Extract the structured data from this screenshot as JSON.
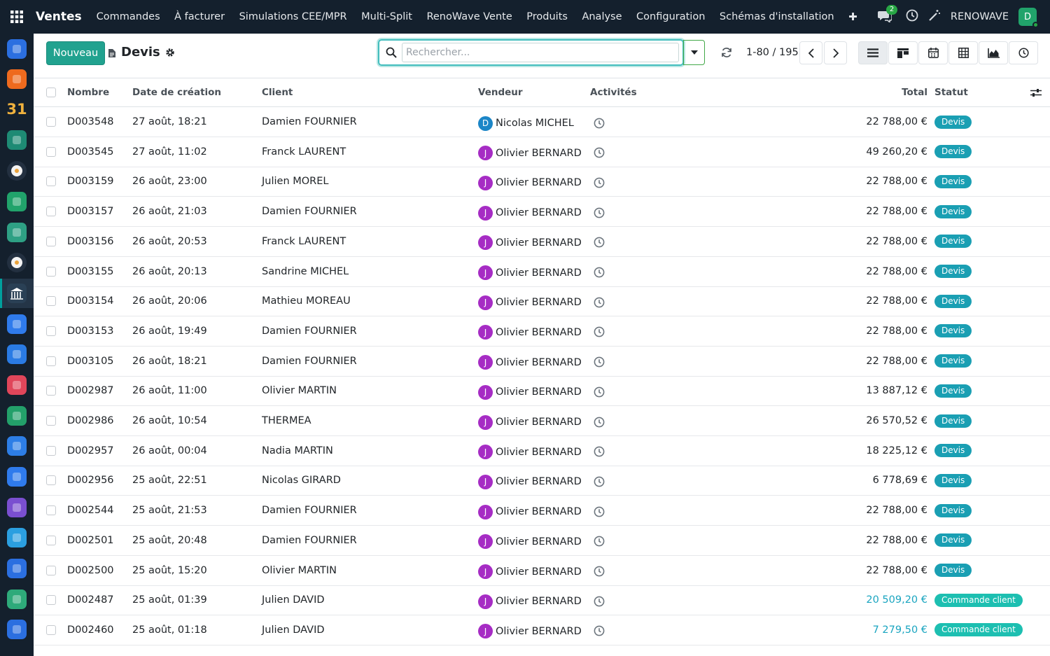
{
  "navbar": {
    "brand": "Ventes",
    "menu": [
      "Commandes",
      "À facturer",
      "Simulations CEE/MPR",
      "Multi-Split",
      "RenoWave Vente",
      "Produits",
      "Analyse",
      "Configuration",
      "Schémas d'installation"
    ],
    "plus": "✚",
    "chat_count": "2",
    "company": "RENOWAVE",
    "user_initial": "D"
  },
  "dock": {
    "calendar_label": "31",
    "apps": [
      {
        "icon": "blue-app-icon",
        "color": "#2b6fe0"
      },
      {
        "icon": "orange-chat-icon",
        "color": "#ee6a1e"
      },
      {
        "icon": "calendar-31-icon",
        "color": "#e9a23b"
      },
      {
        "icon": "pen-app-icon",
        "color": "#1e8a74"
      },
      {
        "icon": "vinyl-app-icon",
        "color": "#233040"
      },
      {
        "icon": "contacts-app-icon",
        "color": "#21a36b"
      },
      {
        "icon": "check-app-icon",
        "color": "#2ea084"
      },
      {
        "icon": "vinyl-app-icon",
        "color": "#233040"
      },
      {
        "icon": "bank-app-icon",
        "color": "#2a4055"
      },
      {
        "icon": "blue-square-icon",
        "color": "#2f7bec"
      },
      {
        "icon": "planner-app-icon",
        "color": "#2a7be4"
      },
      {
        "icon": "dashboard-app-icon",
        "color": "#e0465a"
      },
      {
        "icon": "green-app-icon",
        "color": "#23a06a"
      },
      {
        "icon": "calendar-app-icon",
        "color": "#2d7ee6"
      },
      {
        "icon": "blue-square-icon",
        "color": "#2f7bec"
      },
      {
        "icon": "purple-app-icon",
        "color": "#7a4fd0"
      },
      {
        "icon": "doc-app-icon",
        "color": "#2b9fe0"
      },
      {
        "icon": "people-app-icon",
        "color": "#2b6fe0"
      },
      {
        "icon": "spreadsheet-app-icon",
        "color": "#2eaa7a"
      },
      {
        "icon": "signature-app-icon",
        "color": "#2b6fe0"
      }
    ]
  },
  "control": {
    "new_label": "Nouveau",
    "title": "Devis",
    "search_placeholder": "Rechercher...",
    "pager": "1-80 / 195"
  },
  "columns": {
    "name": "Nombre",
    "date": "Date de création",
    "client": "Client",
    "vendor": "Vendeur",
    "activities": "Activités",
    "total": "Total",
    "status": "Statut"
  },
  "colors": {
    "accent": "#21a28f",
    "devis_badge": "#1a9fb3",
    "order_badge": "#1dbfb1",
    "order_total": "#1aa5c0",
    "vendor_d": "#1c86c7",
    "vendor_j": "#a62cc4"
  },
  "rows": [
    {
      "number": "D003548",
      "date": "27 août, 18:21",
      "client": "Damien FOURNIER",
      "vendor_initial": "D",
      "vendor": "Nicolas MICHEL",
      "total": "22 788,00 €",
      "status": "Devis",
      "kind": "devis"
    },
    {
      "number": "D003545",
      "date": "27 août, 11:02",
      "client": "Franck LAURENT",
      "vendor_initial": "J",
      "vendor": "Olivier BERNARD",
      "total": "49 260,20 €",
      "status": "Devis",
      "kind": "devis"
    },
    {
      "number": "D003159",
      "date": "26 août, 23:00",
      "client": "Julien MOREL",
      "vendor_initial": "J",
      "vendor": "Olivier BERNARD",
      "total": "22 788,00 €",
      "status": "Devis",
      "kind": "devis"
    },
    {
      "number": "D003157",
      "date": "26 août, 21:03",
      "client": "Damien FOURNIER",
      "vendor_initial": "J",
      "vendor": "Olivier BERNARD",
      "total": "22 788,00 €",
      "status": "Devis",
      "kind": "devis"
    },
    {
      "number": "D003156",
      "date": "26 août, 20:53",
      "client": "Franck LAURENT",
      "vendor_initial": "J",
      "vendor": "Olivier BERNARD",
      "total": "22 788,00 €",
      "status": "Devis",
      "kind": "devis"
    },
    {
      "number": "D003155",
      "date": "26 août, 20:13",
      "client": "Sandrine MICHEL",
      "vendor_initial": "J",
      "vendor": "Olivier BERNARD",
      "total": "22 788,00 €",
      "status": "Devis",
      "kind": "devis"
    },
    {
      "number": "D003154",
      "date": "26 août, 20:06",
      "client": "Mathieu MOREAU",
      "vendor_initial": "J",
      "vendor": "Olivier BERNARD",
      "total": "22 788,00 €",
      "status": "Devis",
      "kind": "devis"
    },
    {
      "number": "D003153",
      "date": "26 août, 19:49",
      "client": "Damien FOURNIER",
      "vendor_initial": "J",
      "vendor": "Olivier BERNARD",
      "total": "22 788,00 €",
      "status": "Devis",
      "kind": "devis"
    },
    {
      "number": "D003105",
      "date": "26 août, 18:21",
      "client": "Damien FOURNIER",
      "vendor_initial": "J",
      "vendor": "Olivier BERNARD",
      "total": "22 788,00 €",
      "status": "Devis",
      "kind": "devis"
    },
    {
      "number": "D002987",
      "date": "26 août, 11:00",
      "client": "Olivier MARTIN",
      "vendor_initial": "J",
      "vendor": "Olivier BERNARD",
      "total": "13 887,12 €",
      "status": "Devis",
      "kind": "devis"
    },
    {
      "number": "D002986",
      "date": "26 août, 10:54",
      "client": "THERMEA",
      "vendor_initial": "J",
      "vendor": "Olivier BERNARD",
      "total": "26 570,52 €",
      "status": "Devis",
      "kind": "devis"
    },
    {
      "number": "D002957",
      "date": "26 août, 00:04",
      "client": "Nadia MARTIN",
      "vendor_initial": "J",
      "vendor": "Olivier BERNARD",
      "total": "18 225,12 €",
      "status": "Devis",
      "kind": "devis"
    },
    {
      "number": "D002956",
      "date": "25 août, 22:51",
      "client": "Nicolas GIRARD",
      "vendor_initial": "J",
      "vendor": "Olivier BERNARD",
      "total": "6 778,69 €",
      "status": "Devis",
      "kind": "devis"
    },
    {
      "number": "D002544",
      "date": "25 août, 21:53",
      "client": "Damien FOURNIER",
      "vendor_initial": "J",
      "vendor": "Olivier BERNARD",
      "total": "22 788,00 €",
      "status": "Devis",
      "kind": "devis"
    },
    {
      "number": "D002501",
      "date": "25 août, 20:48",
      "client": "Damien FOURNIER",
      "vendor_initial": "J",
      "vendor": "Olivier BERNARD",
      "total": "22 788,00 €",
      "status": "Devis",
      "kind": "devis"
    },
    {
      "number": "D002500",
      "date": "25 août, 15:20",
      "client": "Olivier MARTIN",
      "vendor_initial": "J",
      "vendor": "Olivier BERNARD",
      "total": "22 788,00 €",
      "status": "Devis",
      "kind": "devis"
    },
    {
      "number": "D002487",
      "date": "25 août, 01:39",
      "client": "Julien DAVID",
      "vendor_initial": "J",
      "vendor": "Olivier BERNARD",
      "total": "20 509,20 €",
      "status": "Commande client",
      "kind": "order"
    },
    {
      "number": "D002460",
      "date": "25 août, 01:18",
      "client": "Julien DAVID",
      "vendor_initial": "J",
      "vendor": "Olivier BERNARD",
      "total": "7 279,50 €",
      "status": "Commande client",
      "kind": "order"
    }
  ]
}
